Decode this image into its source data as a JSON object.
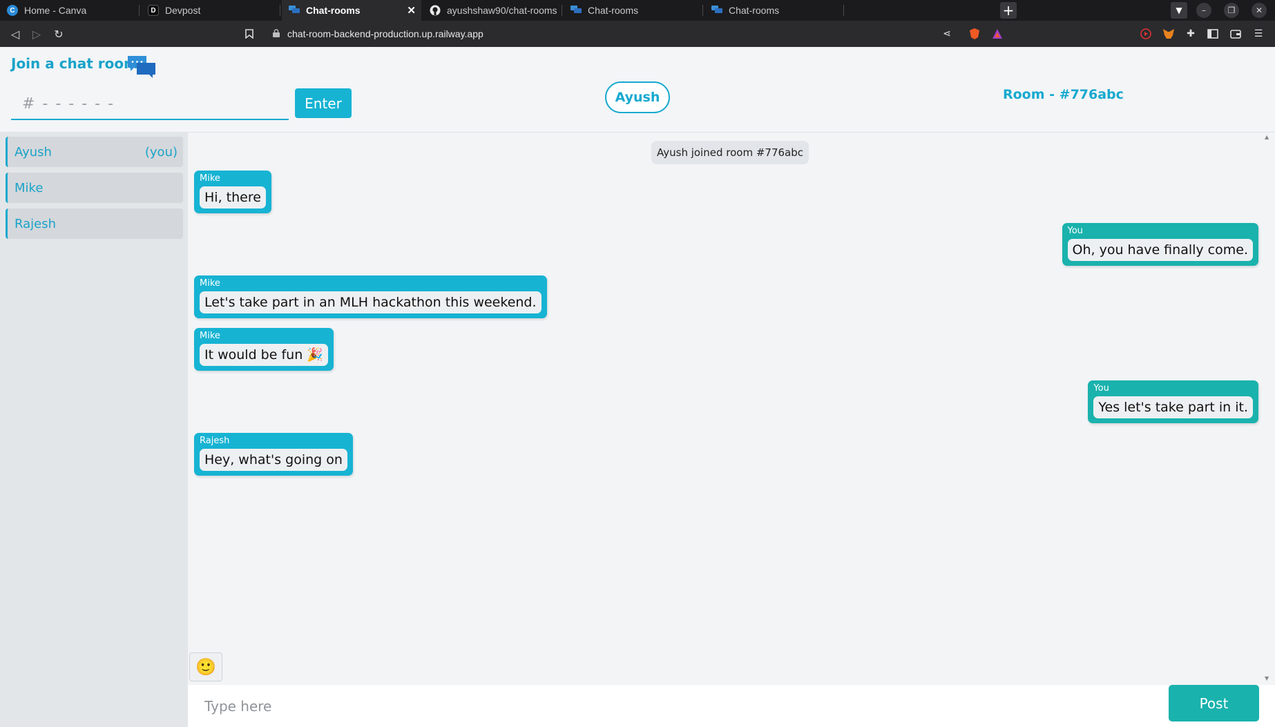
{
  "browser": {
    "tabs": [
      {
        "title": "Home - Canva",
        "icon": "canva-icon",
        "active": false
      },
      {
        "title": "Devpost",
        "icon": "devpost-icon",
        "active": false
      },
      {
        "title": "Chat-rooms",
        "icon": "chat-rooms-favicon",
        "active": true
      },
      {
        "title": "ayushshaw90/chat-rooms",
        "icon": "github-icon",
        "active": false
      },
      {
        "title": "Chat-rooms",
        "icon": "chat-rooms-favicon",
        "active": false
      },
      {
        "title": "Chat-rooms",
        "icon": "chat-rooms-favicon",
        "active": false
      }
    ],
    "url": "chat-room-backend-production.up.railway.app"
  },
  "header": {
    "join_title": "Join a chat room",
    "room_input_placeholder": "# - - - - - -",
    "enter_label": "Enter",
    "current_user": "Ayush",
    "room_label": "Room - #776abc"
  },
  "sidebar": {
    "members": [
      {
        "name": "Ayush",
        "suffix": "(you)"
      },
      {
        "name": "Mike",
        "suffix": ""
      },
      {
        "name": "Rajesh",
        "suffix": ""
      }
    ]
  },
  "chat": {
    "system_message": "Ayush joined room #776abc",
    "messages": [
      {
        "sender": "Mike",
        "text": "Hi, there",
        "mine": false
      },
      {
        "sender": "You",
        "text": "Oh, you have finally come.",
        "mine": true
      },
      {
        "sender": "Mike",
        "text": "Let's take part in an MLH hackathon this weekend.",
        "mine": false
      },
      {
        "sender": "Mike",
        "text": "It would be fun 🎉",
        "mine": false
      },
      {
        "sender": "You",
        "text": "Yes let's take part in it.",
        "mine": true
      },
      {
        "sender": "Rajesh",
        "text": "Hey, what's going on",
        "mine": false
      }
    ]
  },
  "composer": {
    "emoji": "🙂",
    "placeholder": "Type here",
    "post_label": "Post"
  },
  "colors": {
    "accent": "#17b3d3",
    "own_message": "#1ab2ad",
    "post_button": "#1ab2ad"
  }
}
